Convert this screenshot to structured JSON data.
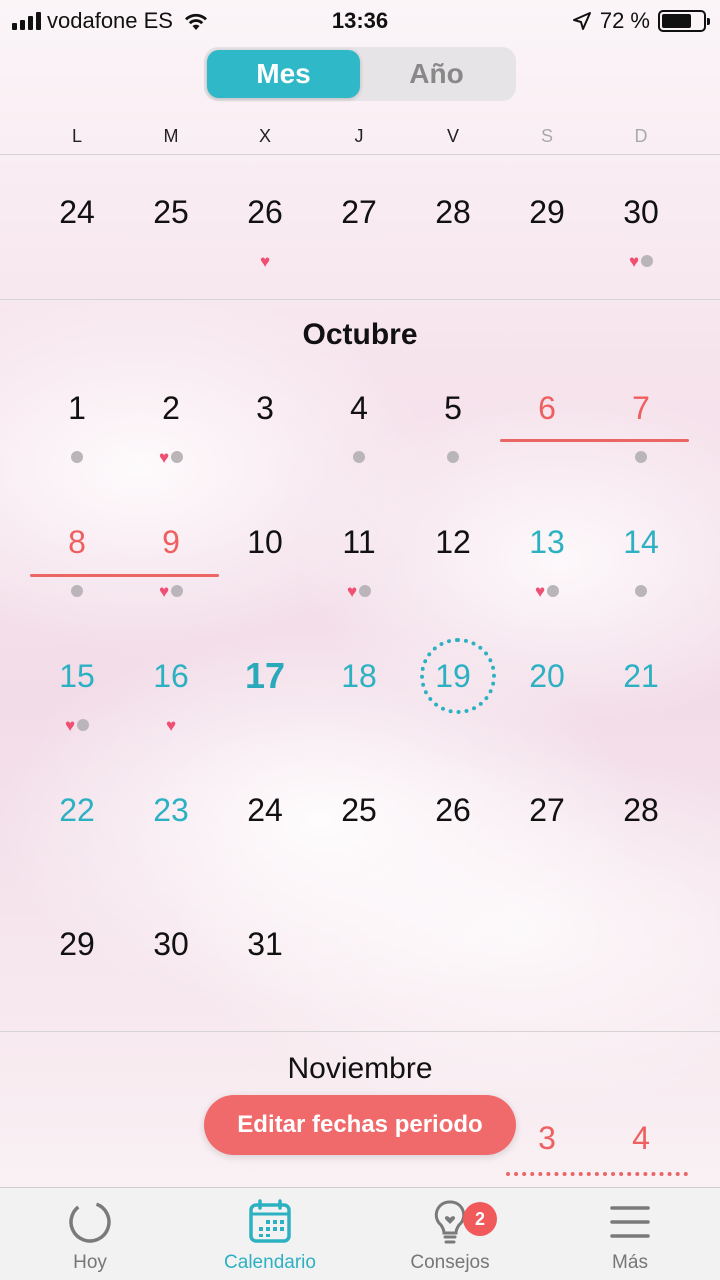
{
  "status_bar": {
    "carrier": "vodafone ES",
    "time": "13:36",
    "battery": "72 %",
    "battery_level": 0.72
  },
  "segmented": {
    "options": [
      "Mes",
      "Año"
    ],
    "selected": "Mes"
  },
  "weekdays": [
    "L",
    "M",
    "X",
    "J",
    "V",
    "S",
    "D"
  ],
  "prev_week": [
    "24",
    "25",
    "26",
    "27",
    "28",
    "29",
    "30"
  ],
  "october": {
    "title": "Octubre",
    "weeks": [
      [
        "1",
        "2",
        "3",
        "4",
        "5",
        "6",
        "7"
      ],
      [
        "8",
        "9",
        "10",
        "11",
        "12",
        "13",
        "14"
      ],
      [
        "15",
        "16",
        "17",
        "18",
        "19",
        "20",
        "21"
      ],
      [
        "22",
        "23",
        "24",
        "25",
        "26",
        "27",
        "28"
      ],
      [
        "29",
        "30",
        "31"
      ]
    ],
    "today": "17",
    "predicted_day": "19"
  },
  "november": {
    "title": "Noviembre",
    "visible_days": [
      "3",
      "4"
    ]
  },
  "edit_button": "Editar fechas periodo",
  "tabs": [
    {
      "label": "Hoy",
      "icon": "ring-icon"
    },
    {
      "label": "Calendario",
      "icon": "calendar-icon"
    },
    {
      "label": "Consejos",
      "icon": "lightbulb-icon",
      "badge": "2"
    },
    {
      "label": "Más",
      "icon": "menu-icon"
    }
  ],
  "colors": {
    "accent": "#2cb1c3",
    "period": "#ee5f5f",
    "heart": "#ef4f72",
    "button": "#f06a6b"
  }
}
